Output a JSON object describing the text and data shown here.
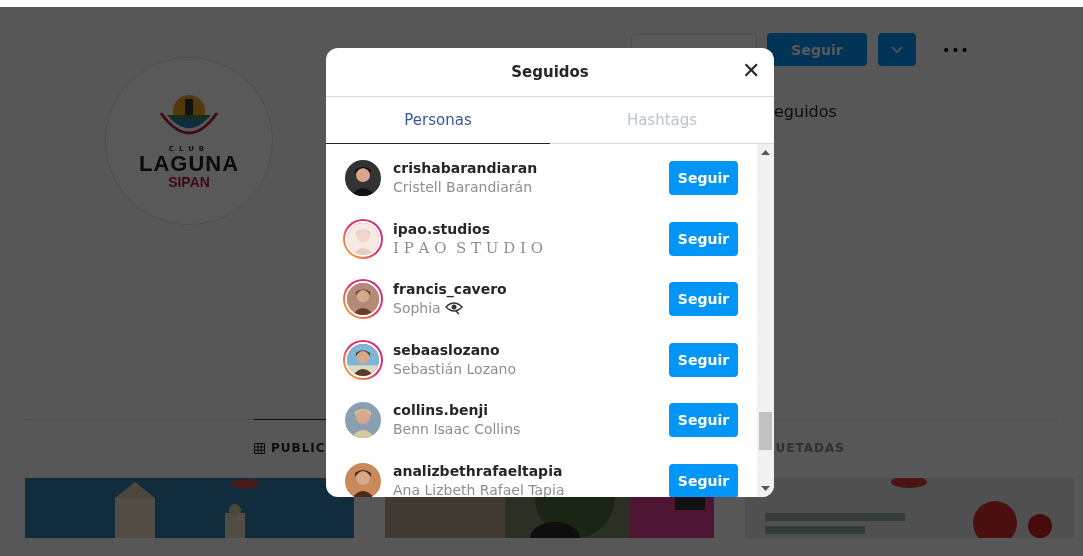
{
  "profile": {
    "logo": {
      "top": "CLUB",
      "main": "LAGUNA",
      "sub": "SIPAN"
    },
    "actions": {
      "follow": "Seguir",
      "more": "•••"
    },
    "stats_fragment": "eguidos"
  },
  "profile_tabs": [
    {
      "label": "PUBLIC",
      "selected": true,
      "icon": true
    },
    {
      "label": "UETADAS",
      "selected": false,
      "icon": false
    }
  ],
  "modal": {
    "title": "Seguidos",
    "close": "✕",
    "tabs": [
      {
        "label": "Personas",
        "selected": true
      },
      {
        "label": "Hashtags",
        "selected": false
      }
    ],
    "users": [
      {
        "username": "crishabarandiaran",
        "name": "Cristell Barandiarán",
        "story_ring": false,
        "kind": "plain",
        "name_icon": false,
        "button": "Seguir"
      },
      {
        "username": "ipao.studios",
        "name": "I P A O  S T U D I O",
        "story_ring": true,
        "kind": "spaced",
        "name_icon": false,
        "button": "Seguir"
      },
      {
        "username": "francis_cavero",
        "name": "Sophia",
        "story_ring": true,
        "kind": "plain",
        "name_icon": true,
        "button": "Seguir"
      },
      {
        "username": "sebaaslozano",
        "name": "Sebastián Lozano",
        "story_ring": true,
        "kind": "plain",
        "name_icon": false,
        "button": "Seguir"
      },
      {
        "username": "collins.benji",
        "name": "Benn Isaac Collins",
        "story_ring": false,
        "kind": "plain",
        "name_icon": false,
        "button": "Seguir"
      },
      {
        "username": "analizbethrafaeltapia",
        "name": "Ana Lizbeth Rafael Tapia",
        "story_ring": false,
        "kind": "plain",
        "name_icon": false,
        "button": "Seguir"
      }
    ]
  }
}
